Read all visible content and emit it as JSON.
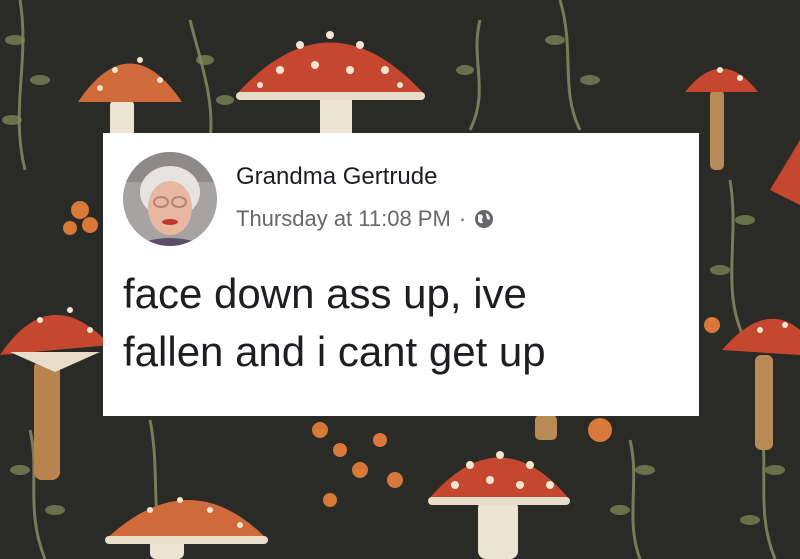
{
  "post": {
    "author_name": "Grandma Gertrude",
    "timestamp": "Thursday at 11:08 PM",
    "separator": "·",
    "audience_icon": "globe-icon",
    "text_lines": [
      "face down ass up, ive",
      "fallen and i cant get up"
    ]
  },
  "colors": {
    "background": "#2a2a26",
    "card": "#ffffff",
    "name_text": "#1c1e21",
    "meta_text": "#65676b",
    "mushroom_cap": "#c6472f",
    "mushroom_spots": "#f3e6d0"
  }
}
